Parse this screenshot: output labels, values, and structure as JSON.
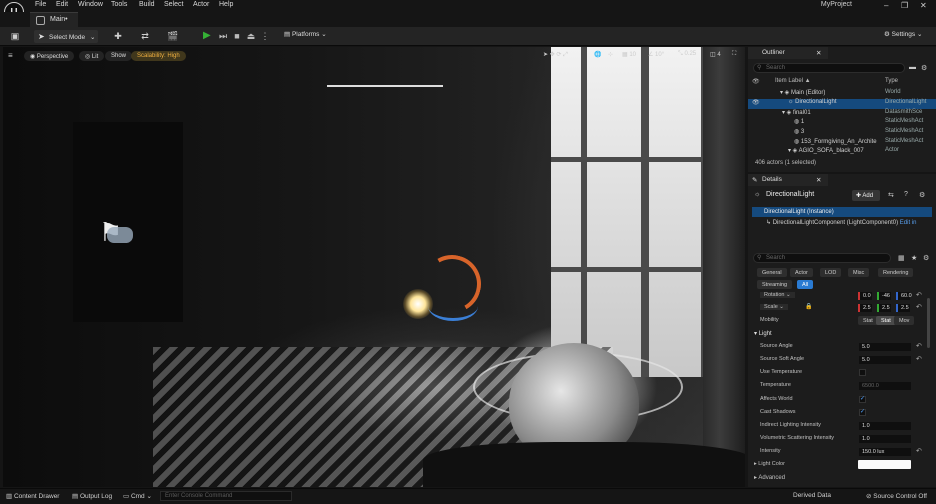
{
  "menu": [
    "File",
    "Edit",
    "Window",
    "Tools",
    "Build",
    "Select",
    "Actor",
    "Help"
  ],
  "project_name": "MyProject",
  "tab": {
    "label": "Main•"
  },
  "toolbar": {
    "select_mode": "Select Mode",
    "platforms": "Platforms",
    "settings": "Settings"
  },
  "viewport": {
    "perspective": "Perspective",
    "lit": "Lit",
    "show": "Show",
    "scalability": "Scalability: High",
    "grid_snap": "10",
    "rot_snap": "10°",
    "scale_snap": "0.25",
    "cam_speed": "4"
  },
  "outliner": {
    "title": "Outliner",
    "search_placeholder": "Search",
    "col_label": "Item Label ▲",
    "col_type": "Type",
    "rows": [
      {
        "name": "Main (Editor)",
        "type": "World"
      },
      {
        "name": "DirectionalLight",
        "type": "DirectionalLight"
      },
      {
        "name": "final01",
        "type": "DatasmithSce"
      },
      {
        "name": "1",
        "type": "StaticMeshAct"
      },
      {
        "name": "3",
        "type": "StaticMeshAct"
      },
      {
        "name": "153_Formgiving_An_Archite",
        "type": "StaticMeshAct"
      },
      {
        "name": "AGIO_SOFA_black_007",
        "type": "Actor"
      }
    ],
    "count": "406 actors (1 selected)"
  },
  "details": {
    "title": "Details",
    "actor_name": "DirectionalLight",
    "add": "Add",
    "instance": "DirectionalLight (Instance)",
    "component": "DirectionalLightComponent (LightComponent0)",
    "edit_link": "Edit in",
    "search_placeholder": "Search",
    "filters": [
      "General",
      "Actor",
      "LOD",
      "Misc",
      "Rendering",
      "Streaming",
      "All"
    ],
    "rotation_label": "Rotation",
    "rotation": [
      "0.0",
      "-46",
      "60.0"
    ],
    "scale_label": "Scale",
    "scale": [
      "2.5",
      "2.5",
      "2.5"
    ],
    "mobility_label": "Mobility",
    "mobility": [
      "Stat",
      "Stat",
      "Mov"
    ],
    "section_light": "Light",
    "props": [
      {
        "label": "Source Angle",
        "value": "5.0"
      },
      {
        "label": "Source Soft Angle",
        "value": "5.0"
      },
      {
        "label": "Use Temperature",
        "value": ""
      },
      {
        "label": "Temperature",
        "value": "6500.0"
      },
      {
        "label": "Affects World",
        "value": "✓"
      },
      {
        "label": "Cast Shadows",
        "value": "✓"
      },
      {
        "label": "Indirect Lighting Intensity",
        "value": "1.0"
      },
      {
        "label": "Volumetric Scattering Intensity",
        "value": "1.0"
      },
      {
        "label": "Intensity",
        "value": "150.0 lux"
      },
      {
        "label": "Light Color",
        "value": ""
      }
    ],
    "section_advanced": "Advanced"
  },
  "statusbar": {
    "content_drawer": "Content Drawer",
    "output_log": "Output Log",
    "cmd": "Cmd",
    "console_placeholder": "Enter Console Command",
    "derived_data": "Derived Data",
    "source_control": "Source Control Off"
  },
  "colors": {
    "accent": "#2a7bd3",
    "selected_row": "#154a7e",
    "play": "#35b135",
    "scalability": "#f0b040"
  }
}
